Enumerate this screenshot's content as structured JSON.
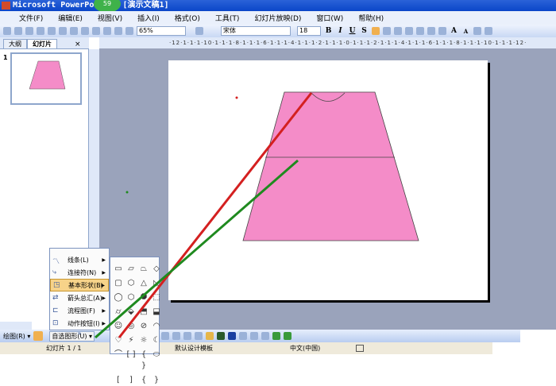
{
  "window": {
    "title": "Microsoft PowerPoint - [演示文稿1]",
    "badge": "59"
  },
  "menu": [
    "文件(F)",
    "编辑(E)",
    "视图(V)",
    "插入(I)",
    "格式(O)",
    "工具(T)",
    "幻灯片放映(D)",
    "窗口(W)",
    "帮助(H)"
  ],
  "toolbar": {
    "zoom": "65%",
    "font": "宋体",
    "size": "18",
    "bold": "B",
    "italic": "I",
    "underline": "U",
    "shadow": "S",
    "grow": "A",
    "shrink": "A"
  },
  "panel": {
    "tabs": [
      "大纲",
      "幻灯片"
    ],
    "close": "×",
    "slide_number": "1"
  },
  "ruler": "·12·1·1·1·10·1·1·1·8·1·1·1·6·1·1·1·4·1·1·1·2·1·1·1·0·1·1·1·2·1·1·1·4·1·1·1·6·1·1·1·8·1·1·1·10·1·1·1·12·",
  "autoshape_menu": {
    "items": [
      {
        "label": "线条(L)",
        "icon": "lines-icon"
      },
      {
        "label": "连接符(N)",
        "icon": "connector-icon"
      },
      {
        "label": "基本形状(B)",
        "icon": "basic-shapes-icon",
        "active": true
      },
      {
        "label": "箭头总汇(A)",
        "icon": "arrows-icon"
      },
      {
        "label": "流程图(F)",
        "icon": "flowchart-icon"
      },
      {
        "label": "动作按钮(I)",
        "icon": "action-button-icon"
      }
    ],
    "expand": "»"
  },
  "basic_shapes": [
    "▭",
    "▱",
    "⏢",
    "◇",
    "▢",
    "⬡",
    "△",
    "◺",
    "◯",
    "⬡",
    "⯃",
    "⬚",
    "⌭",
    "⬙",
    "⬒",
    "⬓",
    "☺",
    "◎",
    "⊘",
    "◠",
    "♡",
    "⚡",
    "☼",
    "☾",
    "⌒",
    "[ ]",
    "{ }",
    "⬭",
    "[",
    "]",
    "{",
    "}"
  ],
  "drawbar": {
    "draw": "绘图(R) ▾",
    "autoshapes": "自选图形(U) ▾"
  },
  "status": {
    "slide": "幻灯片 1 / 1",
    "template": "默认设计模板",
    "language": "中文(中国)"
  },
  "colors": {
    "shape_fill": "#f48cc8",
    "red_line": "#d42020",
    "green_line": "#1f8a1f",
    "canvas": "#9aa3bb"
  }
}
